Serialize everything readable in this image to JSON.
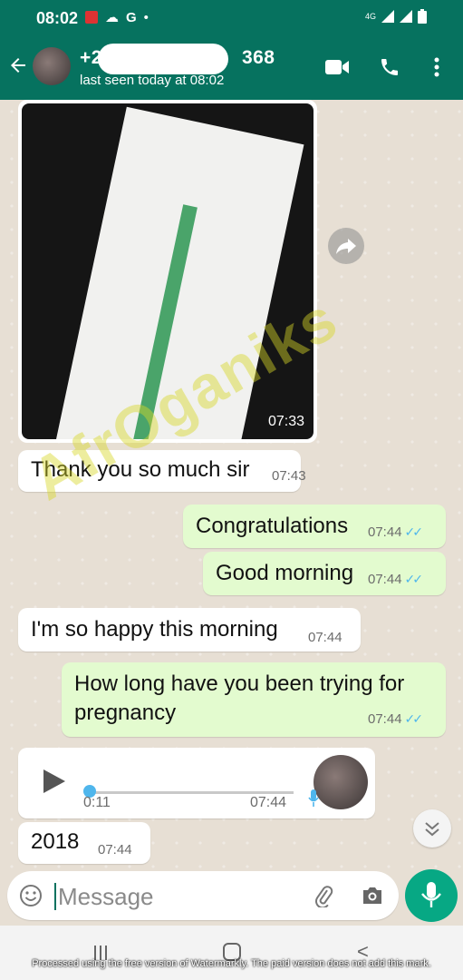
{
  "status_bar": {
    "time": "08:02",
    "network": "4G"
  },
  "header": {
    "contact_prefix": "+2",
    "contact_suffix": "368",
    "last_seen": "last seen today at 08:02",
    "icons": [
      "back-arrow-icon",
      "video-call-icon",
      "phone-icon",
      "more-vert-icon"
    ]
  },
  "messages": [
    {
      "type": "image",
      "direction": "in",
      "time": "07:33"
    },
    {
      "type": "text",
      "direction": "in",
      "text": "Thank you so much sir",
      "time": "07:43"
    },
    {
      "type": "text",
      "direction": "out",
      "text": "Congratulations",
      "time": "07:44",
      "read": true
    },
    {
      "type": "text",
      "direction": "out",
      "text": "Good morning",
      "time": "07:44",
      "read": true
    },
    {
      "type": "text",
      "direction": "in",
      "text": "I'm so happy this morning",
      "time": "07:44"
    },
    {
      "type": "text",
      "direction": "out",
      "text_line1": "How long have you been trying for",
      "text_line2": "pregnancy",
      "time": "07:44",
      "read": true
    },
    {
      "type": "voice",
      "direction": "in",
      "duration": "0:11",
      "time": "07:44"
    },
    {
      "type": "text",
      "direction": "in",
      "text": "2018",
      "time": "07:44"
    }
  ],
  "watermark": "AfrOganiks",
  "input": {
    "placeholder": "Message"
  },
  "footer_note": "Processed using the free version of Watermarkly. The paid version does not add this mark.",
  "colors": {
    "header": "#06725f",
    "outgoing_bubble": "#e3fbcf",
    "incoming_bubble": "#ffffff",
    "read_ticks": "#4fb6ec",
    "mic_button": "#07a884"
  }
}
